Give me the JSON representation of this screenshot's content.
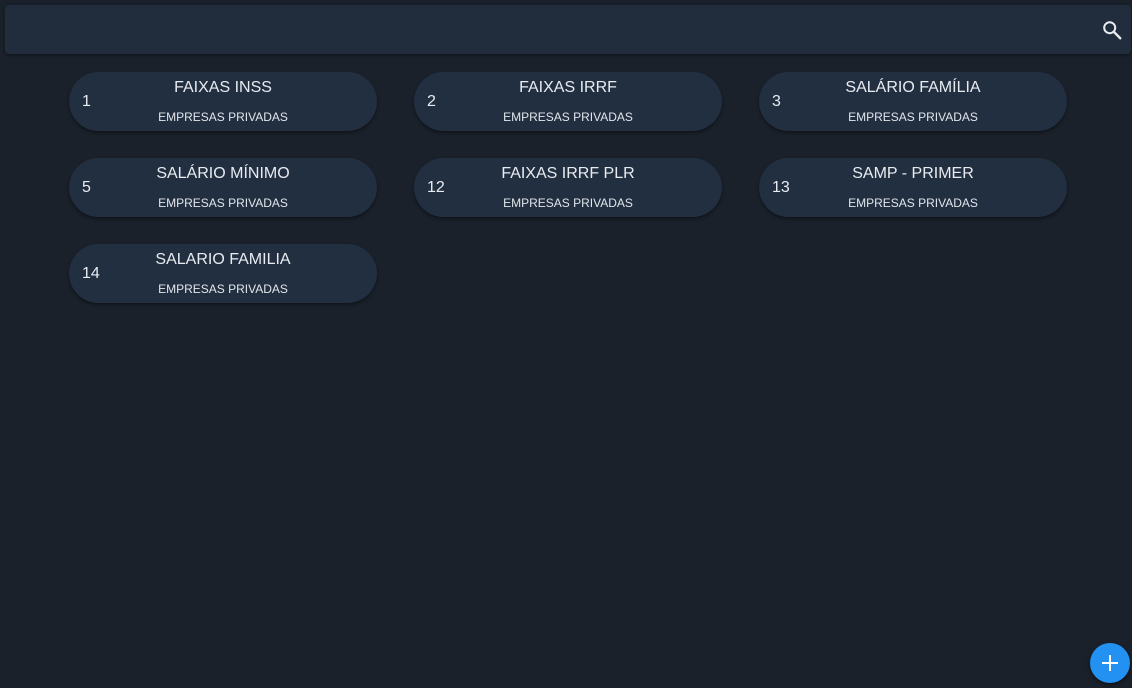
{
  "search": {
    "value": "",
    "placeholder": ""
  },
  "icons": {
    "search": "search-icon",
    "add": "plus-icon"
  },
  "colors": {
    "background": "#1a212b",
    "card": "#222f40",
    "accent": "#2391f2"
  },
  "cards": [
    {
      "number": "1",
      "title": "FAIXAS INSS",
      "subtitle": "EMPRESAS PRIVADAS"
    },
    {
      "number": "2",
      "title": "FAIXAS IRRF",
      "subtitle": "EMPRESAS PRIVADAS"
    },
    {
      "number": "3",
      "title": "SALÁRIO FAMÍLIA",
      "subtitle": "EMPRESAS PRIVADAS"
    },
    {
      "number": "5",
      "title": "SALÁRIO MÍNIMO",
      "subtitle": "EMPRESAS PRIVADAS"
    },
    {
      "number": "12",
      "title": "FAIXAS IRRF PLR",
      "subtitle": "EMPRESAS PRIVADAS"
    },
    {
      "number": "13",
      "title": "SAMP - PRIMER",
      "subtitle": "EMPRESAS PRIVADAS"
    },
    {
      "number": "14",
      "title": "SALARIO FAMILIA",
      "subtitle": "EMPRESAS PRIVADAS"
    }
  ]
}
